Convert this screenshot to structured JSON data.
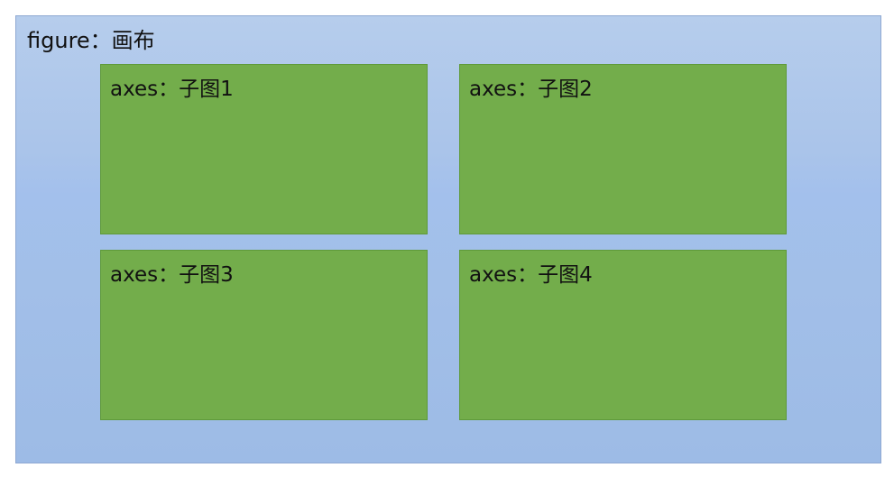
{
  "figure": {
    "label": "figure：画布"
  },
  "axes": [
    {
      "label": "axes：子图1"
    },
    {
      "label": "axes：子图2"
    },
    {
      "label": "axes：子图3"
    },
    {
      "label": "axes：子图4"
    }
  ],
  "colors": {
    "figure_background": "#a3c0ec",
    "figure_border": "#8fa9d2",
    "axes_fill": "#73ad4b",
    "axes_border": "#5f9a3a",
    "text": "#111111"
  }
}
